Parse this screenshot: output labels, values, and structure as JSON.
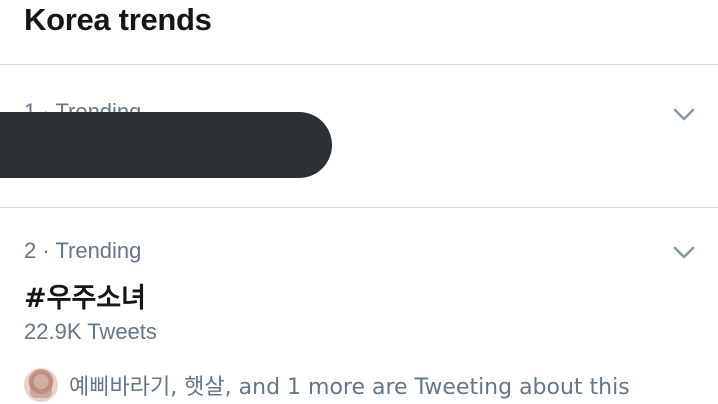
{
  "header": {
    "title": "Korea trends"
  },
  "trends": [
    {
      "meta": "1 · Trending"
    },
    {
      "meta": "2 · Trending",
      "name": "#우주소녀",
      "count": "22.9K Tweets",
      "context": "예삐바라기, 햇살, and 1 more are Tweeting about this"
    }
  ],
  "icons": {
    "chevron": "chevron-down-icon",
    "avatar": "avatar"
  },
  "colors": {
    "primary_text": "#14171a",
    "secondary_text": "#657786",
    "divider": "#cfe0d6",
    "icon": "#8899a6",
    "redaction": "#2b3134"
  }
}
